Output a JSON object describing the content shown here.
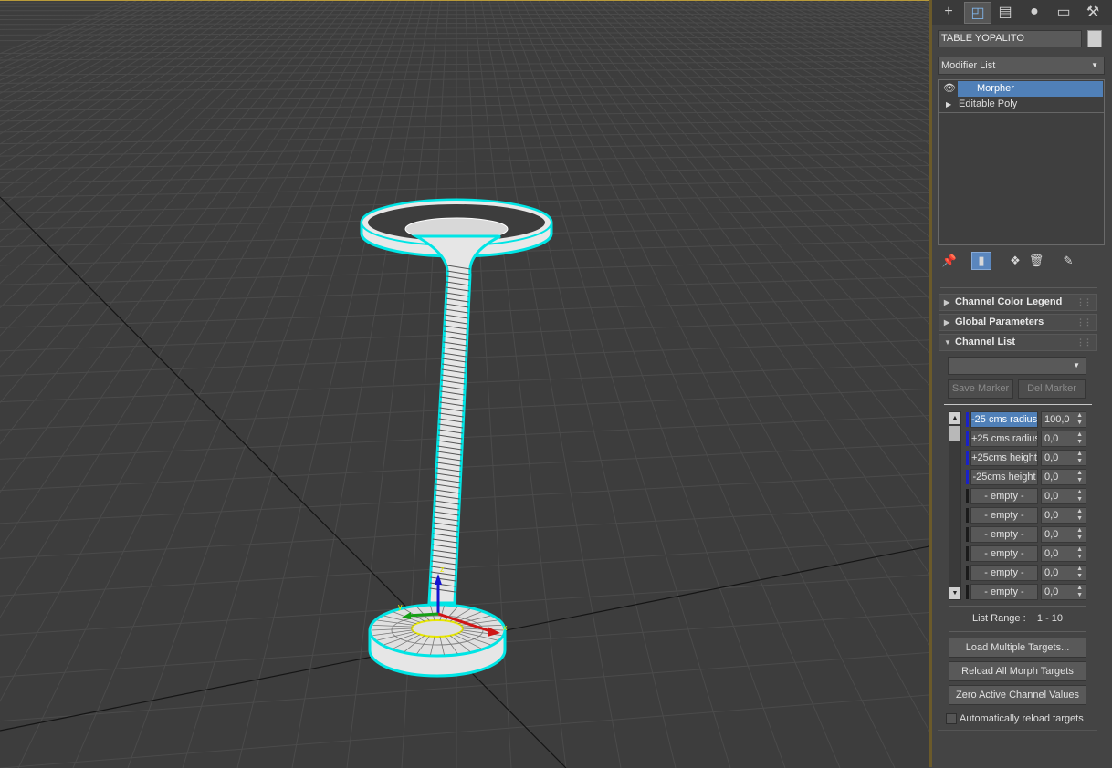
{
  "command_panel": {
    "tabs": [
      {
        "name": "create",
        "icon": "plus-icon"
      },
      {
        "name": "modify",
        "icon": "modify-icon"
      },
      {
        "name": "hierarchy",
        "icon": "hierarchy-icon"
      },
      {
        "name": "motion",
        "icon": "motion-icon"
      },
      {
        "name": "display",
        "icon": "display-icon"
      },
      {
        "name": "utilities",
        "icon": "wrench-icon"
      }
    ],
    "active_tab": "modify",
    "object_name": "TABLE YOPALITO",
    "object_color": "#d0d0d0",
    "modifier_list_label": "Modifier List",
    "stack": [
      {
        "label": "Morpher",
        "selected": true
      },
      {
        "label": "Editable Poly",
        "selected": false
      }
    ]
  },
  "rollouts": {
    "channel_color_legend": "Channel Color Legend",
    "global_parameters": "Global Parameters",
    "channel_list": "Channel List"
  },
  "channel_list": {
    "marker_dropdown_value": "",
    "save_marker": "Save Marker",
    "del_marker": "Del Marker",
    "channels": [
      {
        "name": "-25 cms radius",
        "value": "100,0",
        "color": "#1a22c8",
        "active": true
      },
      {
        "name": "+25 cms radius",
        "value": "0,0",
        "color": "#1a22c8",
        "active": false
      },
      {
        "name": "+25cms height",
        "value": "0,0",
        "color": "#1a22c8",
        "active": false
      },
      {
        "name": "-25cms height",
        "value": "0,0",
        "color": "#1a22c8",
        "active": false
      },
      {
        "name": "- empty -",
        "value": "0,0",
        "color": "#1a1a1a",
        "active": false
      },
      {
        "name": "- empty -",
        "value": "0,0",
        "color": "#1a1a1a",
        "active": false
      },
      {
        "name": "- empty -",
        "value": "0,0",
        "color": "#1a1a1a",
        "active": false
      },
      {
        "name": "- empty -",
        "value": "0,0",
        "color": "#1a1a1a",
        "active": false
      },
      {
        "name": "- empty -",
        "value": "0,0",
        "color": "#1a1a1a",
        "active": false
      },
      {
        "name": "- empty -",
        "value": "0,0",
        "color": "#1a1a1a",
        "active": false
      }
    ],
    "list_range_label": "List Range :",
    "list_range_value": "1 - 10",
    "load_multiple_targets": "Load Multiple Targets...",
    "reload_all_targets": "Reload All Morph Targets",
    "zero_active": "Zero Active Channel Values",
    "auto_reload_label": "Automatically reload targets",
    "auto_reload_checked": false
  },
  "viewport": {
    "background": "#3d3d3d",
    "selection_color": "#00e5e5",
    "gizmo_x_label": "x",
    "gizmo_y_label": "y",
    "gizmo_z_label": "z"
  }
}
